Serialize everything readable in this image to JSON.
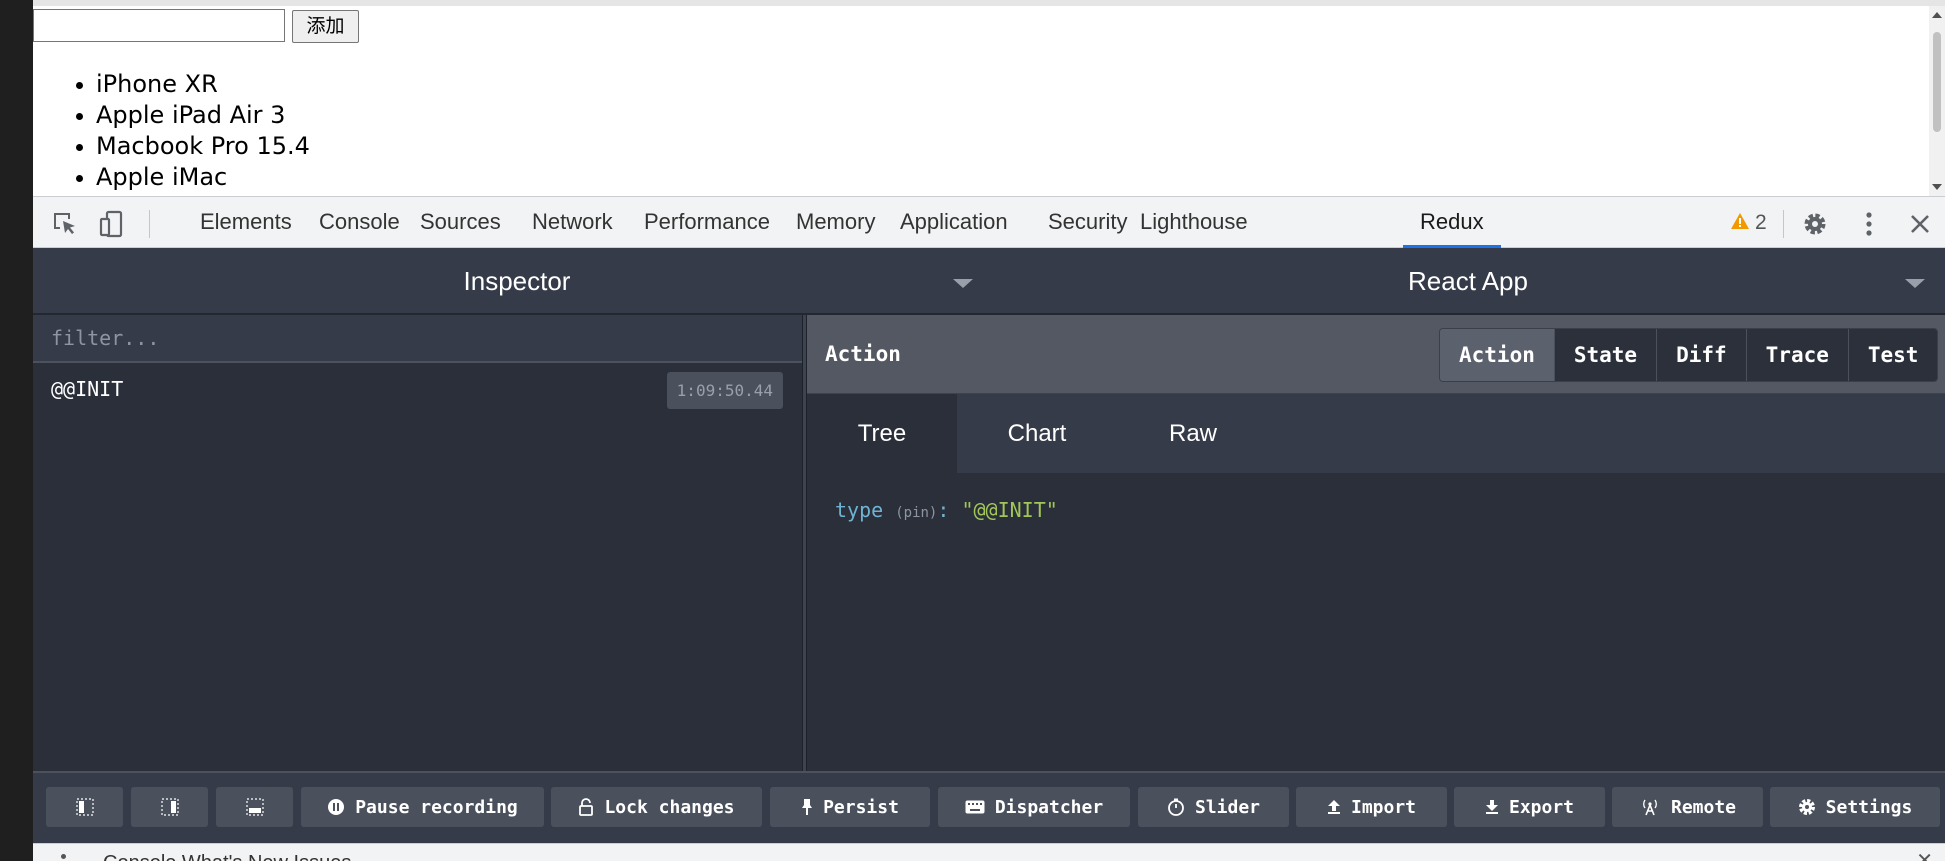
{
  "page": {
    "input_value": "",
    "add_button": "添加",
    "items": [
      "iPhone XR",
      "Apple iPad Air 3",
      "Macbook Pro 15.4",
      "Apple iMac"
    ]
  },
  "devtools": {
    "tabs": [
      "Elements",
      "Console",
      "Sources",
      "Network",
      "Performance",
      "Memory",
      "Application",
      "Security",
      "Lighthouse",
      "Redux"
    ],
    "active_tab": "Redux",
    "warning_count": "2"
  },
  "redux": {
    "inspector_title": "Inspector",
    "app_title": "React App",
    "filter_placeholder": "filter...",
    "actions": [
      {
        "name": "@@INIT",
        "time": "1:09:50.44"
      }
    ],
    "monitor_title": "Action",
    "monitor_tabs": [
      "Action",
      "State",
      "Diff",
      "Trace",
      "Test"
    ],
    "active_monitor_tab": "Action",
    "sub_tabs": [
      "Tree",
      "Chart",
      "Raw"
    ],
    "active_sub_tab": "Tree",
    "tree": {
      "key": "type",
      "pin": "(pin)",
      "colon": ":",
      "value": "\"@@INIT\""
    },
    "footer_buttons": {
      "pause": "Pause recording",
      "lock": "Lock changes",
      "persist": "Persist",
      "dispatcher": "Dispatcher",
      "slider": "Slider",
      "import": "Import",
      "export": "Export",
      "remote": "Remote",
      "settings": "Settings"
    }
  },
  "bottom_strip_text": "Console   What's New   Issues",
  "colors": {
    "accent": "#1a73e8",
    "redux_bg": "#2a2f3a",
    "key_color": "#6fb3d2",
    "value_color": "#a1c659"
  }
}
